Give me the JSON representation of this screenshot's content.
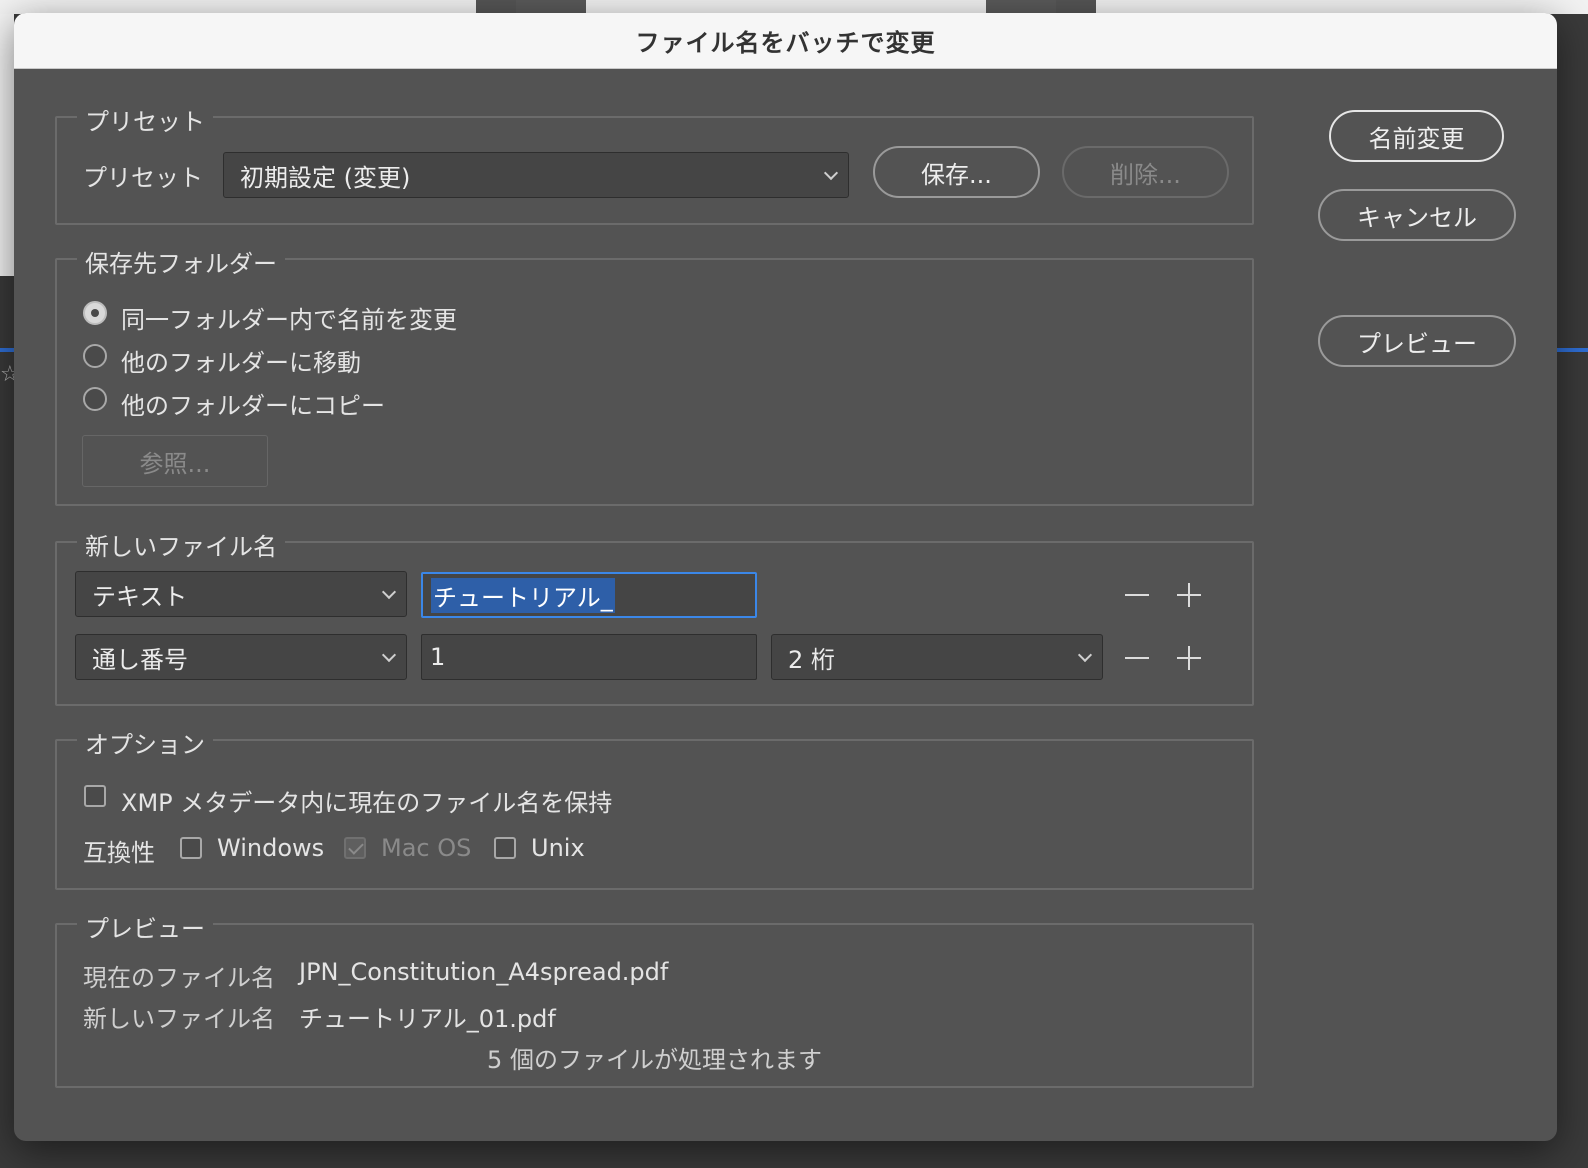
{
  "window": {
    "title": "ファイル名をバッチで変更"
  },
  "preset_group": {
    "legend": "プリセット",
    "label": "プリセット",
    "selected": "初期設定 (変更)",
    "save_button": "保存...",
    "delete_button": "削除..."
  },
  "destination_group": {
    "legend": "保存先フォルダー",
    "options": [
      {
        "label": "同一フォルダー内で名前を変更",
        "selected": true
      },
      {
        "label": "他のフォルダーに移動",
        "selected": false
      },
      {
        "label": "他のフォルダーにコピー",
        "selected": false
      }
    ],
    "browse_button": "参照..."
  },
  "new_name_group": {
    "legend": "新しいファイル名",
    "row1": {
      "type": "テキスト",
      "value": "チュートリアル_"
    },
    "row2": {
      "type": "通し番号",
      "value": "1",
      "digits": "2 桁"
    }
  },
  "options_group": {
    "legend": "オプション",
    "xmp_label": "XMP メタデータ内に現在のファイル名を保持",
    "compat_label": "互換性",
    "windows": "Windows",
    "macos": "Mac OS",
    "unix": "Unix"
  },
  "preview_group": {
    "legend": "プレビュー",
    "current_label": "現在のファイル名",
    "current_value": "JPN_Constitution_A4spread.pdf",
    "new_label": "新しいファイル名",
    "new_value": "チュートリアル_01.pdf",
    "count_text": "5 個のファイルが処理されます"
  },
  "side_buttons": {
    "rename": "名前変更",
    "cancel": "キャンセル",
    "preview": "プレビュー"
  },
  "colors": {
    "dialog_bg": "#535353",
    "focus": "#3b87e8",
    "selection": "#2e5fa8"
  }
}
